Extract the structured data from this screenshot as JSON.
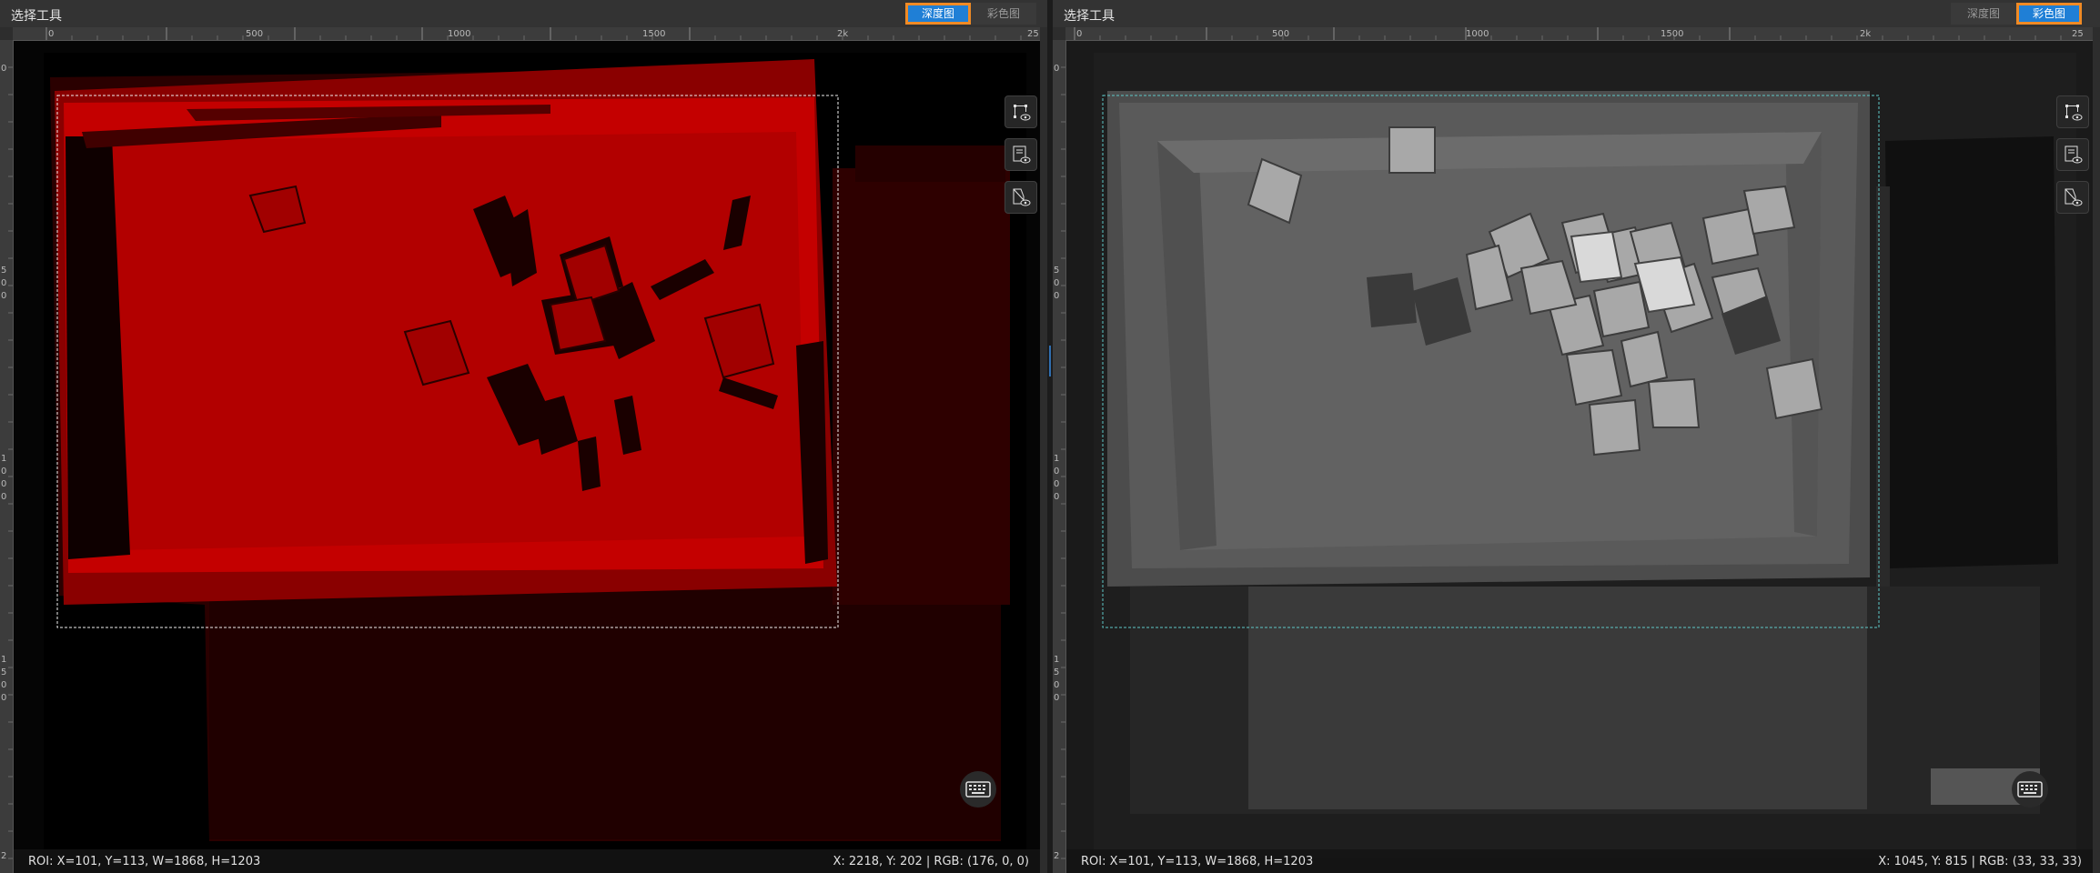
{
  "panels": [
    {
      "id": "depth",
      "title": "选择工具",
      "toggle": {
        "depth_label": "深度图",
        "color_label": "彩色图",
        "active": "depth"
      },
      "ruler_top_labels": [
        "0",
        "500",
        "1000",
        "1500",
        "2k",
        "25"
      ],
      "ruler_left_labels": [
        "0",
        "5\n0\n0",
        "1\n0\n0\n0",
        "1\n5\n0\n0",
        "2"
      ],
      "status_left": "ROI: X=101, Y=113, W=1868, H=1203",
      "status_right": "X: 2218, Y: 202 | RGB: (176, 0, 0)",
      "icons": [
        "roi-visibility-icon",
        "config-visibility-icon",
        "mask-visibility-icon",
        "keyboard-icon"
      ],
      "colors": {
        "accent": "#1f7fd6",
        "highlight": "#f08a24",
        "depth_red": "#c00000",
        "depth_dark": "#2a0000"
      }
    },
    {
      "id": "color",
      "title": "选择工具",
      "toggle": {
        "depth_label": "深度图",
        "color_label": "彩色图",
        "active": "color"
      },
      "ruler_top_labels": [
        "0",
        "500",
        "1000",
        "1500",
        "2k",
        "25"
      ],
      "ruler_left_labels": [
        "0",
        "5\n0\n0",
        "1\n0\n0\n0",
        "1\n5\n0\n0",
        "2"
      ],
      "status_left": "ROI: X=101, Y=113, W=1868, H=1203",
      "status_right": "X: 1045, Y: 815 | RGB: (33, 33, 33)",
      "icons": [
        "roi-visibility-icon",
        "config-visibility-icon",
        "mask-visibility-icon",
        "keyboard-icon"
      ],
      "colors": {
        "roi_border": "#5ec8c8",
        "tray_gray": "#5a5a5a"
      }
    }
  ]
}
